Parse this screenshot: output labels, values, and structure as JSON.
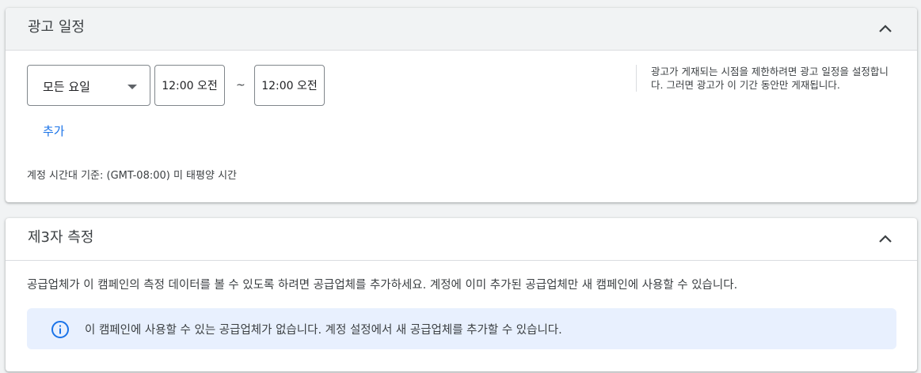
{
  "ad_schedule": {
    "title": "광고 일정",
    "day_select_value": "모든 요일",
    "start_time": "12:00 오전",
    "separator": "~",
    "end_time": "12:00 오전",
    "add_label": "추가",
    "timezone_text": "계정 시간대 기준: (GMT-08:00) 미 태평양 시간",
    "help_text": "광고가 게재되는 시점을 제한하려면 광고 일정을 설정합니다. 그러면 광고가 이 기간 동안만 게재됩니다."
  },
  "third_party": {
    "title": "제3자 측정",
    "description": "공급업체가 이 캠페인의 측정 데이터를 볼 수 있도록 하려면 공급업체를 추가하세요. 계정에 이미 추가된 공급업체만 새 캠페인에 사용할 수 있습니다.",
    "info_message": "이 캠페인에 사용할 수 있는 공급업체가 없습니다. 계정 설정에서 새 공급업체를 추가할 수 있습니다."
  },
  "icons": {
    "collapse": "chevron-up-icon",
    "dropdown": "caret-down-icon",
    "info": "info-icon"
  },
  "colors": {
    "link": "#1a73e8",
    "info_banner_bg": "#e8f0fe",
    "info_icon": "#1a73e8"
  }
}
